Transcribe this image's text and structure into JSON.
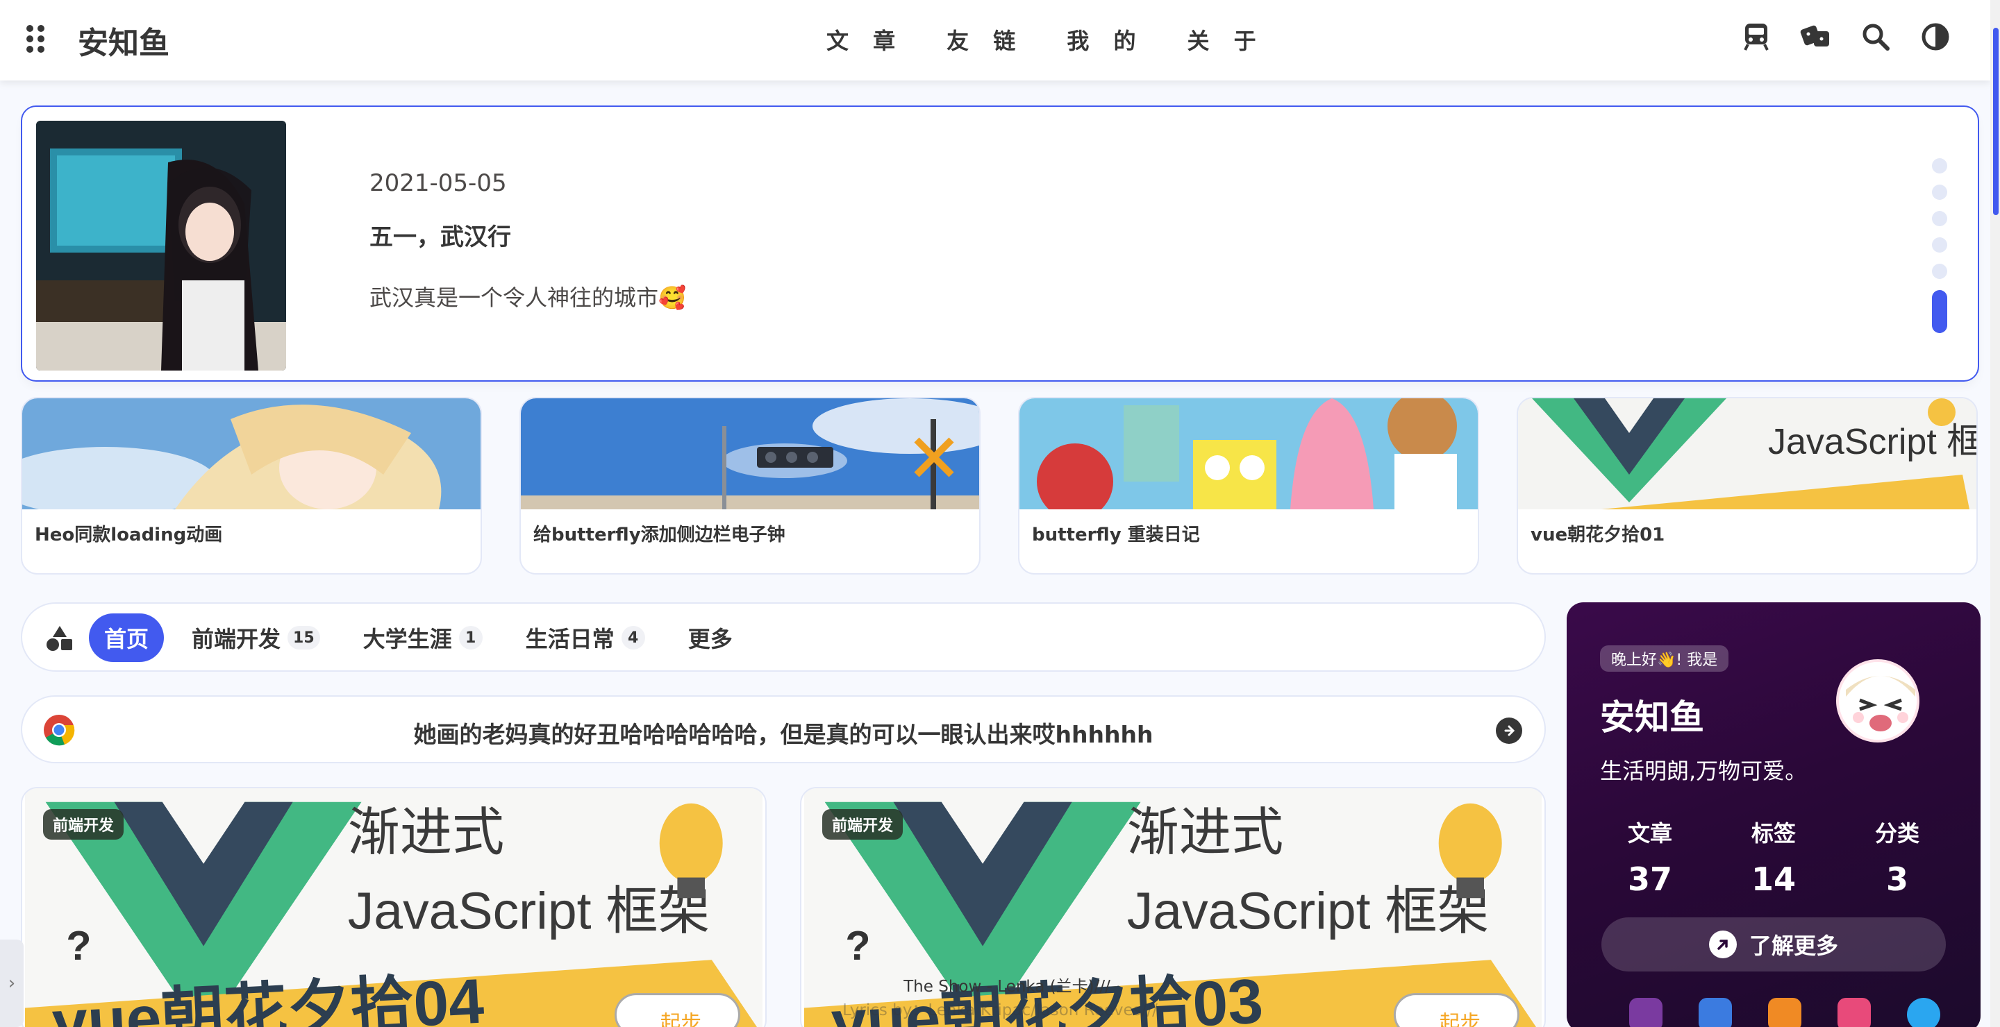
{
  "header": {
    "site_title": "安知鱼",
    "nav": [
      "文 章",
      "友 链",
      "我 的",
      "关 于"
    ],
    "icons": [
      "train-icon",
      "dice-icon",
      "search-icon",
      "darkmode-icon"
    ]
  },
  "swiper": {
    "date": "2021-05-05",
    "title": "五一，武汉行",
    "description": "武汉真是一个令人神往的城市🥰",
    "dot_count": 6,
    "active_dot": 5
  },
  "recent_posts": [
    {
      "title": "Heo同款loading动画"
    },
    {
      "title": "给butterfly添加侧边栏电子钟"
    },
    {
      "title": "butterfly 重装日记"
    },
    {
      "title": "vue朝花夕拾01"
    }
  ],
  "categories": {
    "items": [
      {
        "label": "首页",
        "count": "",
        "active": true
      },
      {
        "label": "前端开发",
        "count": "15",
        "active": false
      },
      {
        "label": "大学生涯",
        "count": "1",
        "active": false
      },
      {
        "label": "生活日常",
        "count": "4",
        "active": false
      },
      {
        "label": "更多",
        "count": "",
        "active": false
      }
    ]
  },
  "bulletin": {
    "text": "她画的老妈真的好丑哈哈哈哈哈哈，但是真的可以一眼认出来哎hhhhhh"
  },
  "posts": [
    {
      "tag": "前端开发",
      "cover_title_1": "渐进式",
      "cover_title_2": "JavaScript 框架",
      "cover_banner": "vue朝花夕拾04",
      "cover_badge": "起步"
    },
    {
      "tag": "前端开发",
      "cover_title_1": "渐进式",
      "cover_title_2": "JavaScript 框架",
      "cover_banner": "vue朝花夕拾03",
      "cover_badge": "起步"
    }
  ],
  "author": {
    "greeting": "晚上好👋! 我是",
    "name": "安知鱼",
    "motto": "生活明朗,万物可爱。",
    "stats": [
      {
        "label": "文章",
        "value": "37"
      },
      {
        "label": "标签",
        "value": "14"
      },
      {
        "label": "分类",
        "value": "3"
      }
    ],
    "more_label": "了解更多",
    "socials": [
      "github-icon",
      "mail-icon",
      "rss-icon",
      "bilibili-icon",
      "qq-icon"
    ]
  },
  "player": {
    "line1": "The Show - Lenka (兰卡)///",
    "line2": "Lyrics by：Lenka Kripac/Jason Reeves///"
  },
  "colors": {
    "accent": "#425aef",
    "background": "#f7f9fe",
    "author_card": "#2a0838",
    "vue_green": "#42b883",
    "vue_dark": "#35495e"
  }
}
